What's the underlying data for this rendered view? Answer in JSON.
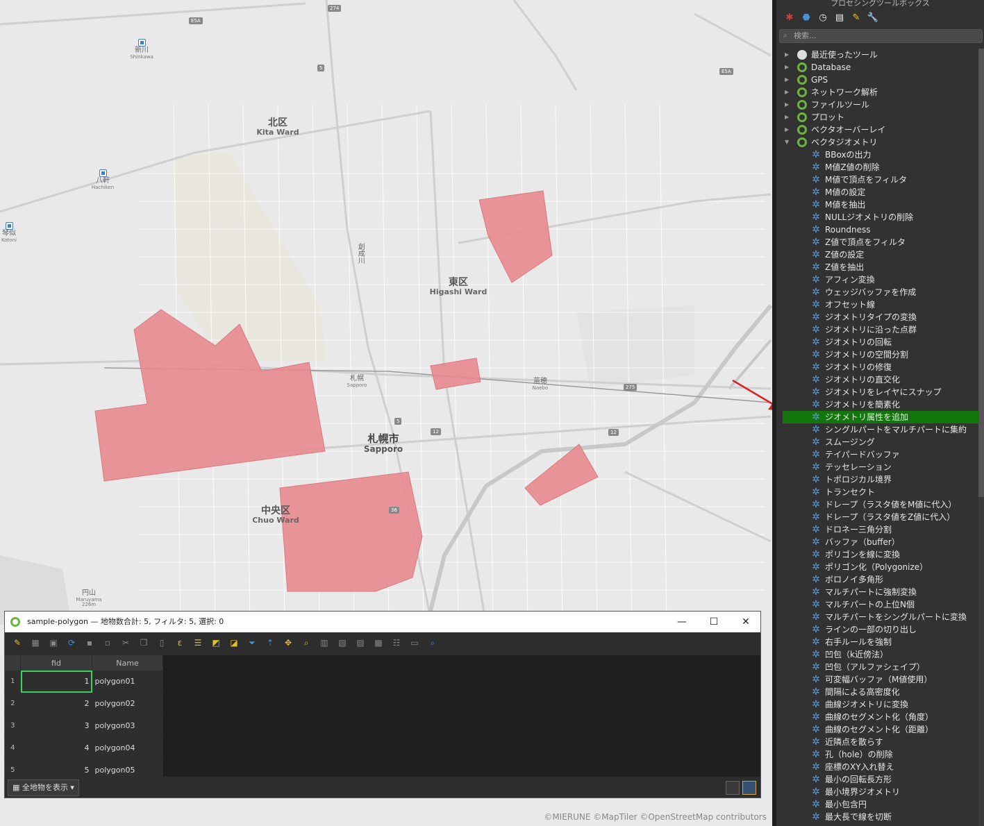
{
  "map": {
    "labels": {
      "kita_ja": "北区",
      "kita_en": "Kita Ward",
      "higashi_ja": "東区",
      "higashi_en": "Higashi Ward",
      "sapporo_ja": "札幌市",
      "sapporo_en": "Sapporo",
      "chuo_ja": "中央区",
      "chuo_en": "Chuo Ward",
      "shinkawa_ja": "新川",
      "shinkawa_en": "Shinkawa",
      "hachiken_ja": "八軒",
      "hachiken_en": "Hachiken",
      "kotoni_ja": "琴似",
      "kotoni_en": "Kotoni",
      "sapporo_st_ja": "札幌",
      "sapporo_st_en": "Sapporo",
      "naebo_ja": "苗穂",
      "naebo_en": "Naebo",
      "maruyama_ja": "円山",
      "maruyama_en": "Maruyama",
      "maruyama_elev": "226m",
      "soseigawa": "創成川"
    },
    "shields": [
      "274",
      "E5A",
      "5",
      "E5A",
      "275",
      "5",
      "12",
      "12",
      "36"
    ],
    "attribution": "©MIERUNE ©MapTiler ©OpenStreetMap contributors",
    "polygon_color": "#e88a8f"
  },
  "toolbox": {
    "title": "プロセシングツールボックス",
    "search_placeholder": "検索...",
    "toolbar_icons": [
      "processing-models-icon",
      "python-icon",
      "history-icon",
      "results-icon",
      "edit-features-icon",
      "options-icon"
    ],
    "categories": [
      {
        "label": "最近使ったツール",
        "icon": "clock-icon",
        "expanded": false
      },
      {
        "label": "Database",
        "icon": "qgis-icon",
        "expanded": false
      },
      {
        "label": "GPS",
        "icon": "qgis-icon",
        "expanded": false
      },
      {
        "label": "ネットワーク解析",
        "icon": "qgis-icon",
        "expanded": false
      },
      {
        "label": "ファイルツール",
        "icon": "qgis-icon",
        "expanded": false
      },
      {
        "label": "プロット",
        "icon": "qgis-icon",
        "expanded": false
      },
      {
        "label": "ベクタオーバーレイ",
        "icon": "qgis-icon",
        "expanded": false
      },
      {
        "label": "ベクタジオメトリ",
        "icon": "qgis-icon",
        "expanded": true
      }
    ],
    "algorithms": [
      "BBoxの出力",
      "M値Z値の削除",
      "M値で頂点をフィルタ",
      "M値の設定",
      "M値を抽出",
      "NULLジオメトリの削除",
      "Roundness",
      "Z値で頂点をフィルタ",
      "Z値の設定",
      "Z値を抽出",
      "アフィン変換",
      "ウェッジバッファを作成",
      "オフセット線",
      "ジオメトリタイプの変換",
      "ジオメトリに沿った点群",
      "ジオメトリの回転",
      "ジオメトリの空間分割",
      "ジオメトリの修復",
      "ジオメトリの直交化",
      "ジオメトリをレイヤにスナップ",
      "ジオメトリを簡素化",
      "ジオメトリ属性を追加",
      "シングルパートをマルチパートに集約",
      "スムージング",
      "テイパードバッファ",
      "テッセレーション",
      "トポロジカル境界",
      "トランセクト",
      "ドレープ（ラスタ値をM値に代入）",
      "ドレープ（ラスタ値をZ値に代入）",
      "ドロネー三角分割",
      "バッファ（buffer）",
      "ポリゴンを線に変換",
      "ポリゴン化（Polygonize）",
      "ボロノイ多角形",
      "マルチパートに強制変換",
      "マルチパートの上位N個",
      "マルチパートをシングルパートに変換",
      "ラインの一部の切り出し",
      "右手ルールを強制",
      "凹包（k近傍法）",
      "凹包（アルファシェイプ）",
      "可変幅バッファ（M値使用）",
      "間隔による高密度化",
      "曲線ジオメトリに変換",
      "曲線のセグメント化（角度）",
      "曲線のセグメント化（距離）",
      "近隣点を散らす",
      "孔（hole）の削除",
      "座標のXY入れ替え",
      "最小の回転長方形",
      "最小境界ジオメトリ",
      "最小包含円",
      "最大長で線を切断"
    ],
    "selected_index": 21,
    "selected_color": "#13760c"
  },
  "attribute_table": {
    "title": "sample-polygon — 地物数合計: 5, フィルタ: 5, 選択: 0",
    "window_buttons": {
      "minimize": "—",
      "maximize": "☐",
      "close": "✕"
    },
    "columns": [
      "fid",
      "Name"
    ],
    "rows": [
      {
        "n": "1",
        "fid": "1",
        "name": "polygon01"
      },
      {
        "n": "2",
        "fid": "2",
        "name": "polygon02"
      },
      {
        "n": "3",
        "fid": "3",
        "name": "polygon03"
      },
      {
        "n": "4",
        "fid": "4",
        "name": "polygon04"
      },
      {
        "n": "5",
        "fid": "5",
        "name": "polygon05"
      }
    ],
    "show_all_label": "全地物を表示"
  }
}
